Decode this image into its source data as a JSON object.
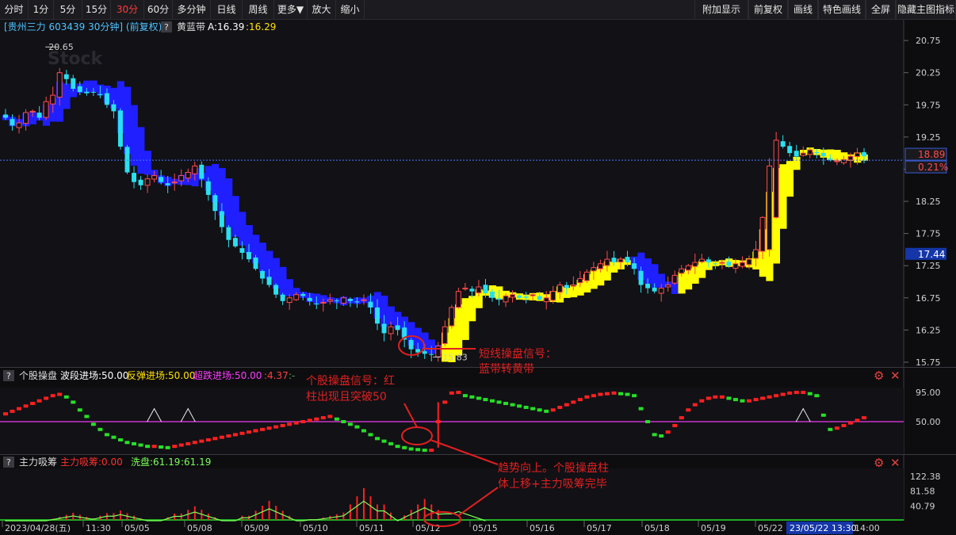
{
  "toolbar": {
    "left": [
      "分时",
      "1分",
      "5分",
      "15分",
      "30分",
      "60分",
      "多分钟",
      "日线",
      "周线",
      "更多▼",
      "放大",
      "缩小"
    ],
    "active": "30分",
    "right": [
      "附加显示",
      "前复权",
      "画线",
      "特色画线",
      "全屏",
      "隐藏主图指标"
    ]
  },
  "main_header": {
    "title": "[贵州三力 603439 30分钟] (前复权)",
    "question": "?",
    "indicator": "黄蓝带",
    "a_label": "A:16.39",
    "a_value": ":16.29"
  },
  "watermark": "Stock",
  "sub1_header": {
    "question": "?",
    "name": "个股操盘",
    "item1": "波段进场:50.00",
    "item2": "反弹进场:50.00",
    "item3": "超跌进场:50.00",
    "item4": ":4.37",
    "item5": ":-"
  },
  "sub2_header": {
    "question": "?",
    "name": "主力吸筹",
    "item1": "主力吸筹:0.00",
    "item2": "洗盘:61.19",
    "item3": ":61.19"
  },
  "annotations": {
    "short_signal": [
      "短线操盘信号：",
      "蓝带转黄带"
    ],
    "stock_signal": [
      "个股操盘信号：红",
      "柱出现且突破50"
    ],
    "trend": [
      "趋势向上。个股操盘柱",
      "体上移+主力吸筹完毕"
    ]
  },
  "price_tags": {
    "current": "18.89",
    "pct": "0.21%",
    "cursor": "17.44"
  },
  "time_axis": {
    "labels": [
      "2023/04/28(五)",
      "11:30",
      "05/05",
      "05/08",
      "05/09",
      "05/10",
      "05/11",
      "05/12",
      "05/15",
      "05/16",
      "05/17",
      "05/18",
      "05/19",
      "05/22"
    ],
    "cursor_label": "23/05/22 13:30",
    "end_label": "14:00"
  },
  "chart_data": [
    {
      "type": "candlestick",
      "title": "[贵州三力 603439 30分钟] (前复权)",
      "y_ticks": [
        20.75,
        20.25,
        19.75,
        19.25,
        18.75,
        18.25,
        17.75,
        17.25,
        16.75,
        16.25,
        15.75
      ],
      "ylim": [
        15.7,
        20.85
      ],
      "high_label": "20.65",
      "low_label": "15.83",
      "bar_count": 128,
      "close": [
        19.55,
        19.43,
        19.47,
        19.63,
        19.65,
        19.55,
        19.8,
        19.9,
        20.25,
        20.15,
        20.0,
        19.95,
        19.93,
        19.95,
        19.9,
        19.75,
        19.65,
        19.1,
        18.7,
        18.55,
        18.5,
        18.6,
        18.65,
        18.55,
        18.5,
        18.55,
        18.65,
        18.7,
        18.8,
        18.6,
        18.35,
        18.1,
        17.85,
        17.65,
        17.55,
        17.45,
        17.35,
        17.2,
        17.05,
        16.95,
        16.8,
        16.7,
        16.75,
        16.8,
        16.78,
        16.7,
        16.65,
        16.68,
        16.72,
        16.7,
        16.75,
        16.7,
        16.68,
        16.72,
        16.6,
        16.35,
        16.2,
        16.3,
        16.25,
        16.1,
        15.95,
        15.9,
        15.88,
        15.87,
        16.0,
        16.3,
        16.6,
        16.85,
        16.9,
        16.85,
        16.92,
        16.82,
        16.75,
        16.72,
        16.78,
        16.8,
        16.75,
        16.75,
        16.8,
        16.72,
        16.75,
        16.85,
        16.95,
        16.9,
        16.95,
        17.05,
        17.15,
        17.22,
        17.28,
        17.35,
        17.3,
        17.35,
        17.3,
        17.2,
        16.95,
        16.9,
        16.85,
        16.9,
        16.95,
        17.1,
        17.2,
        17.25,
        17.3,
        17.35,
        17.3,
        17.28,
        17.3,
        17.25,
        17.28,
        17.3,
        17.35,
        17.5,
        18.0,
        18.8,
        19.2,
        19.1,
        19.0,
        18.95,
        19.0,
        19.05,
        19.0,
        18.95,
        18.9,
        18.88,
        18.9,
        18.95,
        19.0,
        18.95
      ],
      "band_colors": "blue before bar 65, yellow after; blue again bars 93-99"
    },
    {
      "type": "bar",
      "title": "个股操盘",
      "series": [
        {
          "name": "波段进场",
          "value": 50.0
        },
        {
          "name": "反弹进场",
          "value": 50.0
        },
        {
          "name": "超跌进场",
          "value": 50.0
        }
      ],
      "y_ticks": [
        95.0,
        50.0
      ],
      "ylim": [
        0,
        100
      ],
      "oscillator": [
        62,
        66,
        70,
        74,
        78,
        82,
        86,
        90,
        92,
        88,
        80,
        68,
        58,
        46,
        38,
        30,
        26,
        22,
        18,
        16,
        14,
        12,
        12,
        11,
        10,
        12,
        14,
        16,
        18,
        20,
        22,
        24,
        26,
        28,
        30,
        32,
        34,
        36,
        38,
        40,
        42,
        44,
        46,
        48,
        50,
        52,
        54,
        56,
        58,
        54,
        50,
        46,
        42,
        36,
        30,
        24,
        20,
        16,
        12,
        10,
        8,
        7,
        6,
        6,
        50,
        80,
        94,
        95,
        90,
        88,
        86,
        84,
        82,
        80,
        78,
        76,
        74,
        72,
        70,
        68,
        66,
        68,
        72,
        76,
        80,
        84,
        88,
        90,
        92,
        93,
        94,
        93,
        92,
        90,
        70,
        50,
        30,
        28,
        34,
        44,
        56,
        68,
        76,
        82,
        86,
        88,
        88,
        86,
        84,
        82,
        82,
        84,
        86,
        88,
        90,
        92,
        94,
        95,
        95,
        93,
        90,
        60,
        38,
        40,
        44,
        48,
        52,
        56
      ]
    },
    {
      "type": "area",
      "title": "主力吸筹",
      "series": [
        {
          "name": "主力吸筹",
          "value": 0.0
        },
        {
          "name": "洗盘",
          "value": 61.19
        }
      ],
      "y_ticks": [
        122.38,
        81.58,
        40.79
      ],
      "ylim": [
        0,
        140
      ]
    }
  ]
}
